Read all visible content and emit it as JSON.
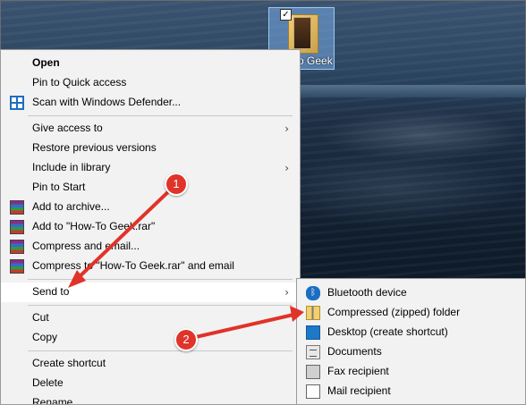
{
  "desktop": {
    "file": {
      "label": "o Geek",
      "icon": "rar-archive-icon",
      "checked": true
    }
  },
  "context_menu": {
    "items": [
      {
        "label": "Open",
        "bold": true,
        "icon": ""
      },
      {
        "label": "Pin to Quick access",
        "icon": ""
      },
      {
        "label": "Scan with Windows Defender...",
        "icon": "windows-defender-icon"
      },
      {
        "label": "Give access to",
        "submenu": true,
        "icon": ""
      },
      {
        "label": "Restore previous versions",
        "icon": ""
      },
      {
        "label": "Include in library",
        "submenu": true,
        "icon": ""
      },
      {
        "label": "Pin to Start",
        "icon": ""
      },
      {
        "label": "Add to archive...",
        "icon": "winrar-icon"
      },
      {
        "label": "Add to \"How-To Geek.rar\"",
        "icon": "winrar-icon"
      },
      {
        "label": "Compress and email...",
        "icon": "winrar-icon"
      },
      {
        "label": "Compress to \"How-To Geek.rar\" and email",
        "icon": "winrar-icon"
      },
      {
        "label": "Send to",
        "submenu": true,
        "highlighted": true,
        "icon": ""
      },
      {
        "label": "Cut",
        "icon": ""
      },
      {
        "label": "Copy",
        "icon": ""
      },
      {
        "label": "Create shortcut",
        "icon": ""
      },
      {
        "label": "Delete",
        "icon": ""
      },
      {
        "label": "Rename",
        "icon": ""
      }
    ],
    "chevron": "›"
  },
  "send_to_menu": {
    "items": [
      {
        "label": "Bluetooth device",
        "icon": "bluetooth-icon"
      },
      {
        "label": "Compressed (zipped) folder",
        "icon": "zip-folder-icon"
      },
      {
        "label": "Desktop (create shortcut)",
        "icon": "desktop-icon"
      },
      {
        "label": "Documents",
        "icon": "documents-icon"
      },
      {
        "label": "Fax recipient",
        "icon": "fax-icon"
      },
      {
        "label": "Mail recipient",
        "icon": "mail-icon"
      }
    ]
  },
  "callouts": [
    {
      "number": "1"
    },
    {
      "number": "2"
    }
  ],
  "colors": {
    "callout_red": "#e0332a",
    "menu_bg": "#f2f2f2",
    "highlight_bg": "#ffffff",
    "accent_blue": "#1b6ec2"
  }
}
